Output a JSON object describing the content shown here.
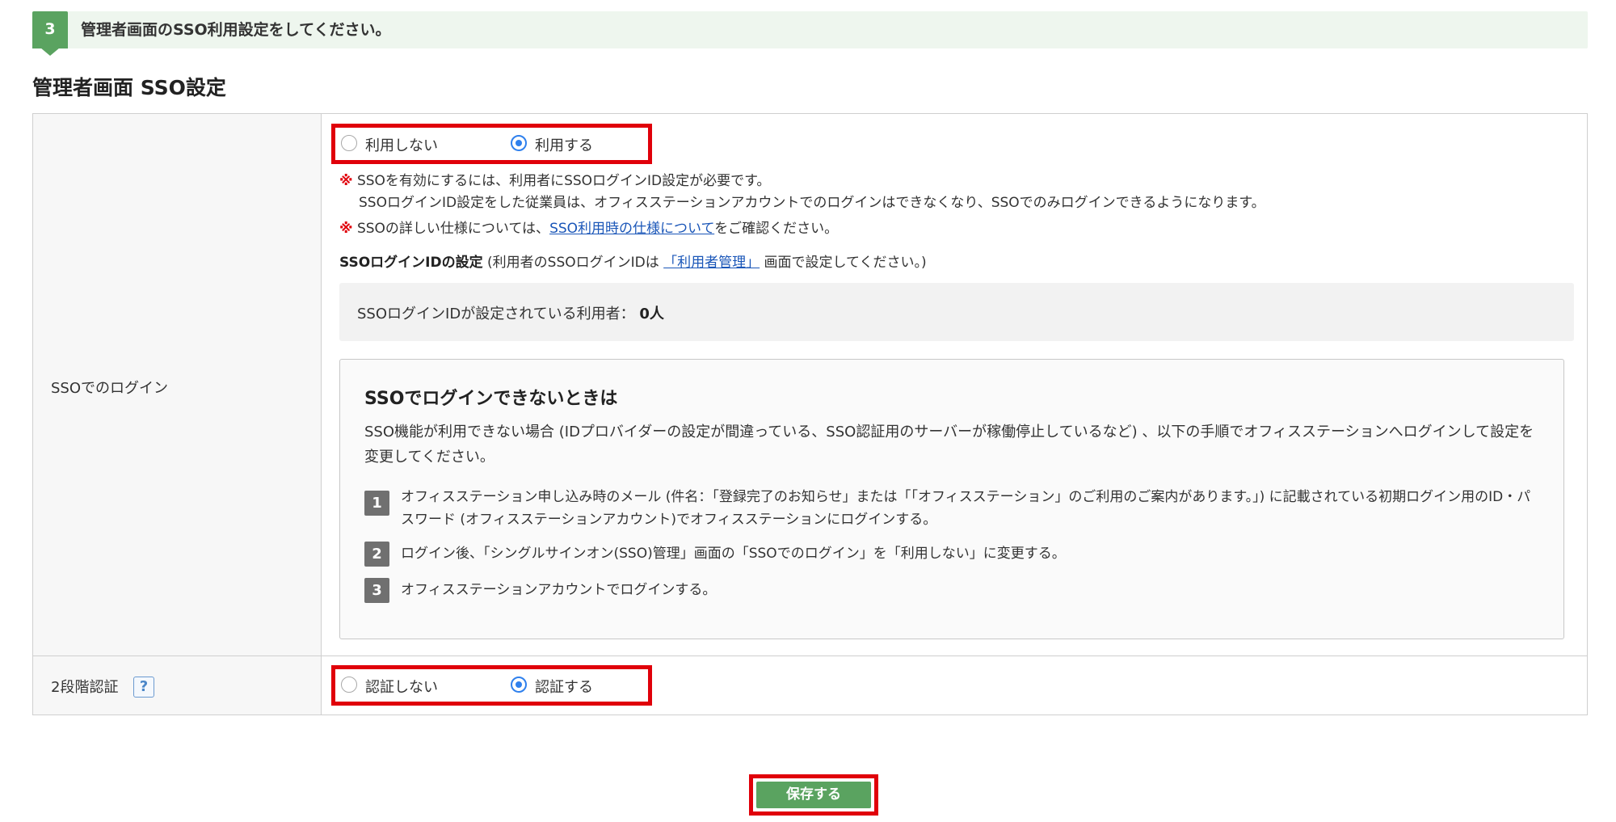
{
  "step": {
    "number": "3",
    "text": "管理者画面のSSO利用設定をしてください。"
  },
  "section_title": "管理者画面 SSO設定",
  "sso_login": {
    "label": "SSOでのログイン",
    "options": [
      {
        "label": "利用しない",
        "checked": false
      },
      {
        "label": "利用する",
        "checked": true
      }
    ],
    "note1_mark": "※",
    "note1_line1": "SSOを有効にするには、利用者にSSOログインID設定が必要です。",
    "note1_line2": "SSOログインID設定をした従業員は、オフィスステーションアカウントでのログインはできなくなり、SSOでのみログインできるようになります。",
    "note2_mark": "※",
    "note2_prefix": "SSOの詳しい仕様については、",
    "note2_link": "SSO利用時の仕様について",
    "note2_suffix": "をご確認ください。",
    "id_setting_bold": "SSOログインIDの設定",
    "id_setting_prefix": " (利用者のSSOログインIDは ",
    "id_setting_link": "「利用者管理」",
    "id_setting_suffix": " 画面で設定してください。)",
    "count_label": "SSOログインIDが設定されている利用者：",
    "count_value": "0人"
  },
  "help_box": {
    "title": "SSOでログインできないときは",
    "description": "SSO機能が利用できない場合 (IDプロバイダーの設定が間違っている、SSO認証用のサーバーが稼働停止しているなど) 、以下の手順でオフィスステーションへログインして設定を変更してください。",
    "steps": [
      {
        "num": "1",
        "text": "オフィスステーション申し込み時のメール (件名：「登録完了のお知らせ」または「「オフィスステーション」のご利用のご案内があります。」) に記載されている初期ログイン用のID・パスワード (オフィスステーションアカウント)でオフィスステーションにログインする。"
      },
      {
        "num": "2",
        "text": "ログイン後、「シングルサインオン(SSO)管理」画面の「SSOでのログイン」を「利用しない」に変更する。"
      },
      {
        "num": "3",
        "text": "オフィスステーションアカウントでログインする。"
      }
    ]
  },
  "two_factor": {
    "label": "2段階認証",
    "help_icon": "?",
    "options": [
      {
        "label": "認証しない",
        "checked": false
      },
      {
        "label": "認証する",
        "checked": true
      }
    ]
  },
  "save_button": "保存する",
  "colors": {
    "accent_green": "#5aa360",
    "highlight_red": "#e0000a",
    "radio_blue": "#2f80ed",
    "link_blue": "#1a56b8"
  }
}
